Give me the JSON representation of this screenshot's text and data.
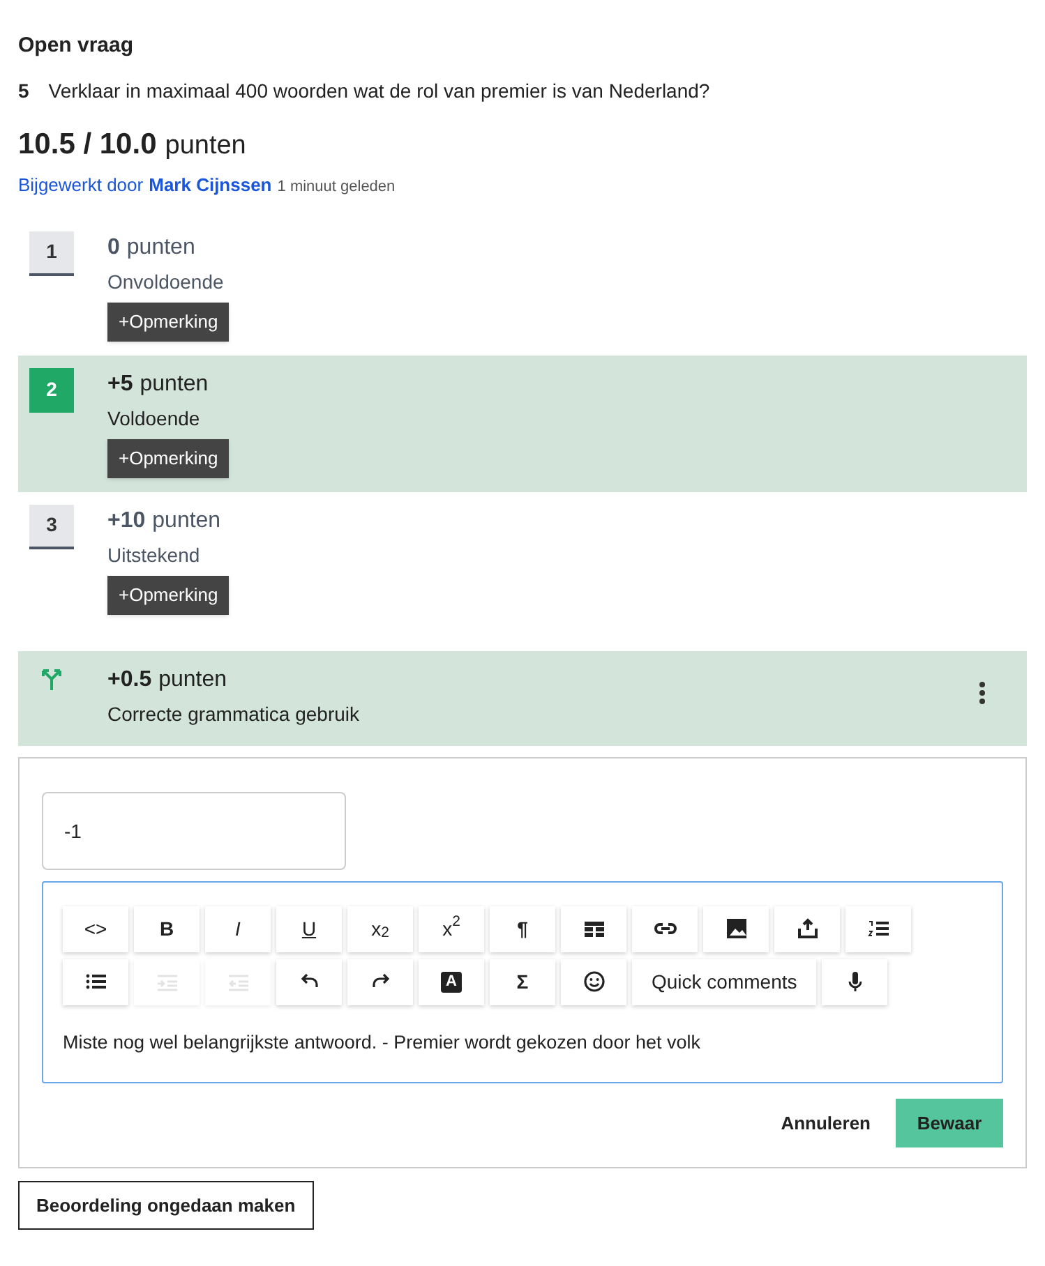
{
  "header": {
    "type_label": "Open vraag",
    "question_number": "5",
    "question": "Verklaar in maximaal 400 woorden wat de rol van premier is van Nederland?",
    "score": "10.5 / 10.0",
    "score_unit": "punten",
    "updated_prefix": "Bijgewerkt door",
    "updated_by": "Mark Cijnssen",
    "updated_time": "1 minuut geleden"
  },
  "criteria": [
    {
      "kind": "level",
      "number": "1",
      "points": "0",
      "unit": "punten",
      "label": "Onvoldoende",
      "selected": false,
      "button": "+Opmerking"
    },
    {
      "kind": "level",
      "number": "2",
      "points": "+5",
      "unit": "punten",
      "label": "Voldoende",
      "selected": true,
      "button": "+Opmerking"
    },
    {
      "kind": "level",
      "number": "3",
      "points": "+10",
      "unit": "punten",
      "label": "Uitstekend",
      "selected": false,
      "button": "+Opmerking"
    },
    {
      "kind": "adjustment",
      "points": "+0.5",
      "unit": "punten",
      "label": "Correcte grammatica gebruik",
      "selected": true
    }
  ],
  "comment_panel": {
    "points_value": "-1",
    "toolbar": [
      {
        "kind": "text",
        "label": "<>",
        "disabled": false
      },
      {
        "kind": "bold",
        "label": "B",
        "disabled": false
      },
      {
        "kind": "italic",
        "label": "I",
        "disabled": false
      },
      {
        "kind": "underline",
        "label": "U",
        "disabled": false
      },
      {
        "kind": "text",
        "label": "x$_{2}$",
        "disabled": false
      },
      {
        "kind": "text",
        "label": "x$^{2}$",
        "disabled": false
      },
      {
        "kind": "bold",
        "label": "¶",
        "disabled": false
      },
      {
        "kind": "icon",
        "disabled": false
      },
      {
        "kind": "icon",
        "disabled": false
      },
      {
        "kind": "icon",
        "disabled": false
      },
      {
        "kind": "icon",
        "disabled": false
      },
      {
        "kind": "icon",
        "disabled": false
      },
      {
        "kind": "icon",
        "disabled": false
      },
      {
        "kind": "icon",
        "disabled": true
      },
      {
        "kind": "icon",
        "disabled": true
      },
      {
        "kind": "icon",
        "disabled": false
      },
      {
        "kind": "icon",
        "disabled": false
      },
      {
        "kind": "badge",
        "label": "A",
        "disabled": false
      },
      {
        "kind": "bold",
        "label": "Σ",
        "disabled": false
      },
      {
        "kind": "icon",
        "disabled": false
      },
      {
        "kind": "wide",
        "label": "Quick comments",
        "disabled": false
      },
      {
        "kind": "icon",
        "disabled": false
      }
    ],
    "text": "Miste nog wel belangrijkste antwoord. - Premier wordt gekozen door het volk",
    "cancel": "Annuleren",
    "save": "Bewaar"
  },
  "undo_button": "Beoordeling ongedaan maken"
}
